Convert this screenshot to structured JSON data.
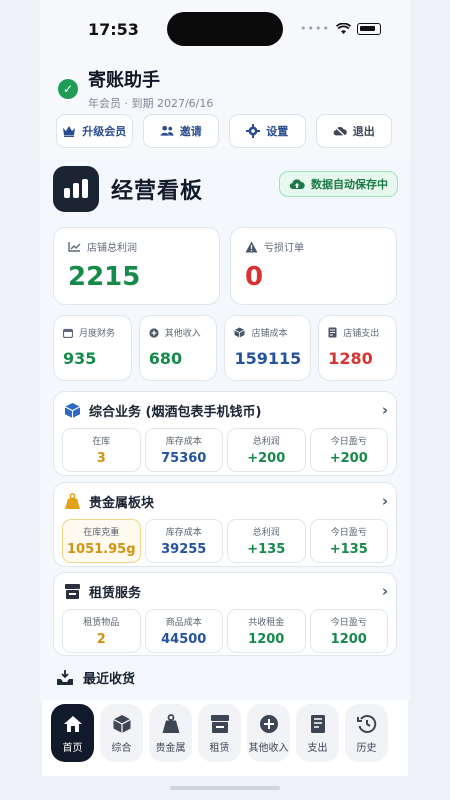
{
  "status": {
    "time": "17:53"
  },
  "user": {
    "name": "寄账助手",
    "subtitle": "年会员 · 到期 2027/6/16"
  },
  "actions": [
    {
      "label": "升级会员",
      "icon": "crown-icon"
    },
    {
      "label": "邀请",
      "icon": "users-icon"
    },
    {
      "label": "设置",
      "icon": "gear-icon"
    },
    {
      "label": "退出",
      "icon": "cloud-off-icon"
    }
  ],
  "dashboard": {
    "title": "经营看板",
    "autosave": "数据自动保存中"
  },
  "summary": [
    {
      "label": "店铺总利润",
      "value": "2215",
      "color": "#168a4a"
    },
    {
      "label": "亏损订单",
      "value": "0",
      "color": "#d73333"
    }
  ],
  "mini": [
    {
      "label": "月度财务",
      "value": "935",
      "color": "#168a4a"
    },
    {
      "label": "其他收入",
      "value": "680",
      "color": "#168a4a"
    },
    {
      "label": "店铺成本",
      "value": "159115",
      "color": "#25539b"
    },
    {
      "label": "店铺支出",
      "value": "1280",
      "color": "#d73333"
    }
  ],
  "sections": [
    {
      "title": "综合业务 (烟酒包表手机钱币)",
      "metrics": [
        {
          "label": "在库",
          "value": "3",
          "color": "#d39312"
        },
        {
          "label": "库存成本",
          "value": "75360",
          "color": "#25539b"
        },
        {
          "label": "总利润",
          "value": "+200",
          "color": "#168a4a"
        },
        {
          "label": "今日盈亏",
          "value": "+200",
          "color": "#168a4a"
        }
      ]
    },
    {
      "title": "贵金属板块",
      "metrics": [
        {
          "label": "在库克重",
          "value": "1051.95g",
          "color": "#d39312"
        },
        {
          "label": "库存成本",
          "value": "39255",
          "color": "#25539b"
        },
        {
          "label": "总利润",
          "value": "+135",
          "color": "#168a4a"
        },
        {
          "label": "今日盈亏",
          "value": "+135",
          "color": "#168a4a"
        }
      ]
    },
    {
      "title": "租赁服务",
      "metrics": [
        {
          "label": "租赁物品",
          "value": "2",
          "color": "#d39312"
        },
        {
          "label": "商品成本",
          "value": "44500",
          "color": "#25539b"
        },
        {
          "label": "共收租金",
          "value": "1200",
          "color": "#168a4a"
        },
        {
          "label": "今日盈亏",
          "value": "1200",
          "color": "#168a4a"
        }
      ]
    }
  ],
  "recent": {
    "title": "最近收货"
  },
  "nav": [
    {
      "label": "首页"
    },
    {
      "label": "综合"
    },
    {
      "label": "贵金属"
    },
    {
      "label": "租赁"
    },
    {
      "label": "其他收入"
    },
    {
      "label": "支出"
    },
    {
      "label": "历史"
    }
  ]
}
